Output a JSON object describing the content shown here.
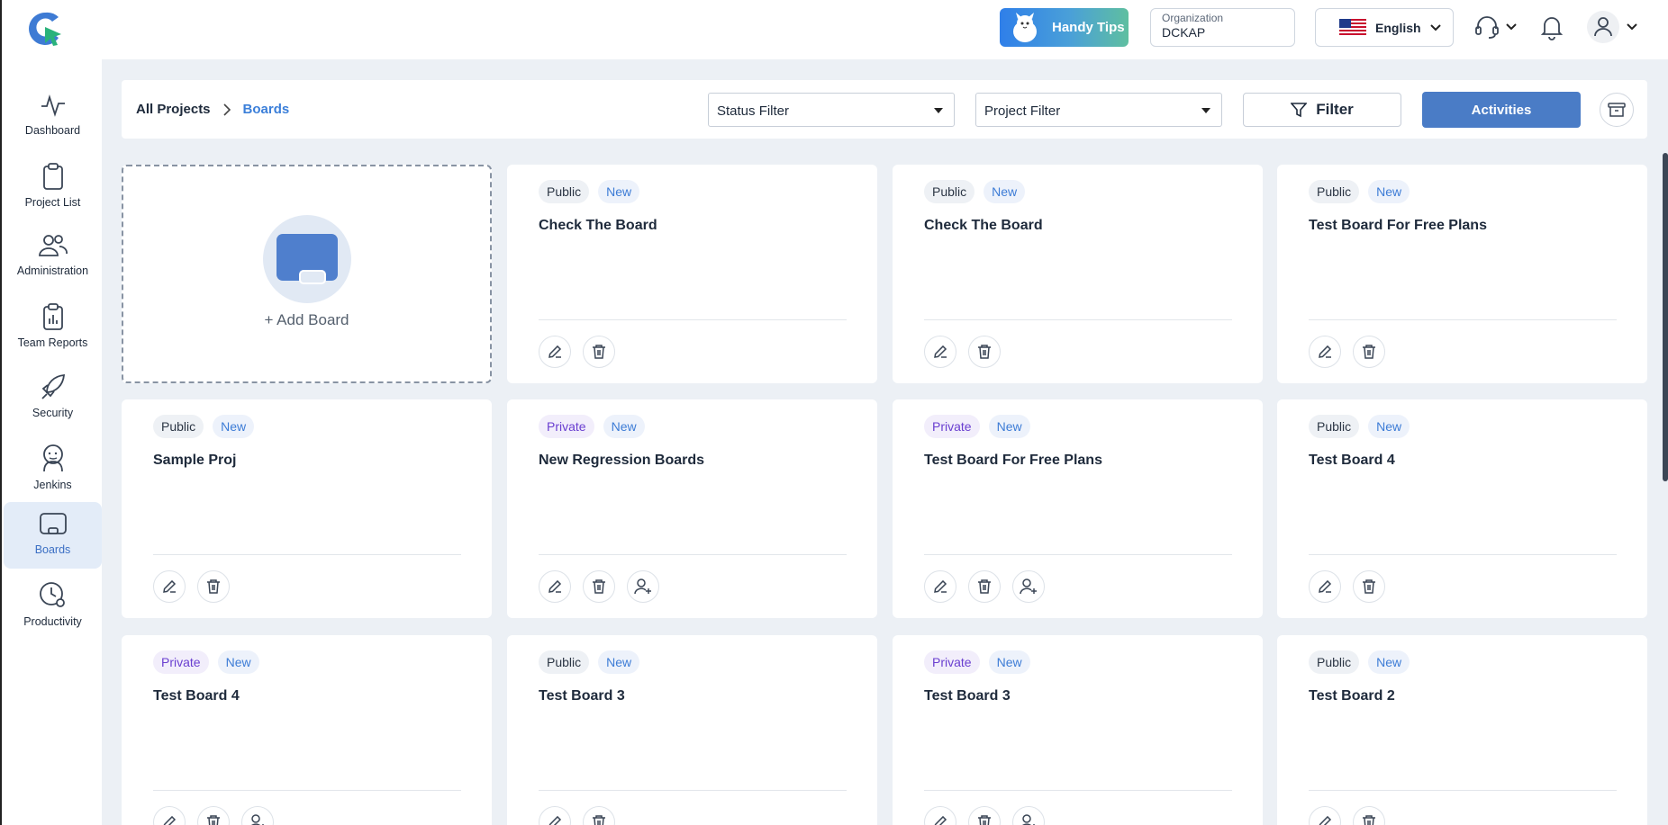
{
  "header": {
    "handy_tips": "Handy Tips",
    "organization_label": "Organization",
    "organization_value": "DCKAP",
    "language": "English"
  },
  "sidebar": {
    "items": [
      {
        "label": "Dashboard",
        "icon": "activity-icon"
      },
      {
        "label": "Project List",
        "icon": "clipboard-icon"
      },
      {
        "label": "Administration",
        "icon": "users-icon"
      },
      {
        "label": "Team Reports",
        "icon": "report-icon"
      },
      {
        "label": "Security",
        "icon": "rocket-icon"
      },
      {
        "label": "Jenkins",
        "icon": "jenkins-icon"
      },
      {
        "label": "Boards",
        "icon": "board-icon",
        "active": true
      },
      {
        "label": "Productivity",
        "icon": "clock-gear-icon"
      }
    ]
  },
  "toolbar": {
    "breadcrumb_root": "All Projects",
    "breadcrumb_current": "Boards",
    "status_filter": "Status Filter",
    "project_filter": "Project Filter",
    "filter_label": "Filter",
    "activities_label": "Activities"
  },
  "add_board": {
    "label": "+ Add Board"
  },
  "boards": [
    {
      "visibility": "Public",
      "status": "New",
      "title": "Check The Board",
      "add_member": false
    },
    {
      "visibility": "Public",
      "status": "New",
      "title": "Check The Board",
      "add_member": false
    },
    {
      "visibility": "Public",
      "status": "New",
      "title": "Test Board For Free Plans",
      "add_member": false
    },
    {
      "visibility": "Public",
      "status": "New",
      "title": "Sample Proj",
      "add_member": false
    },
    {
      "visibility": "Private",
      "status": "New",
      "title": "New Regression Boards",
      "add_member": true
    },
    {
      "visibility": "Private",
      "status": "New",
      "title": "Test Board For Free Plans",
      "add_member": true
    },
    {
      "visibility": "Public",
      "status": "New",
      "title": "Test Board 4",
      "add_member": false
    },
    {
      "visibility": "Private",
      "status": "New",
      "title": "Test Board 4",
      "add_member": true
    },
    {
      "visibility": "Public",
      "status": "New",
      "title": "Test Board 3",
      "add_member": false
    },
    {
      "visibility": "Private",
      "status": "New",
      "title": "Test Board 3",
      "add_member": true
    },
    {
      "visibility": "Public",
      "status": "New",
      "title": "Test Board 2",
      "add_member": false
    }
  ]
}
